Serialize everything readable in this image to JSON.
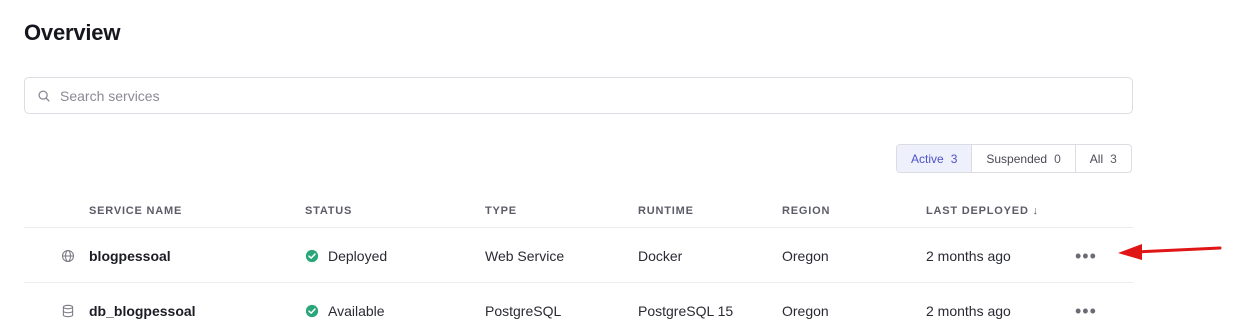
{
  "page": {
    "title": "Overview"
  },
  "search": {
    "placeholder": "Search services"
  },
  "filters": [
    {
      "label": "Active",
      "count": "3",
      "active": true
    },
    {
      "label": "Suspended",
      "count": "0",
      "active": false
    },
    {
      "label": "All",
      "count": "3",
      "active": false
    }
  ],
  "table": {
    "columns": {
      "service_name": "SERVICE NAME",
      "status": "STATUS",
      "type": "TYPE",
      "runtime": "RUNTIME",
      "region": "REGION",
      "last_deployed": "LAST DEPLOYED ↓"
    },
    "rows": [
      {
        "icon": "globe-icon",
        "name": "blogpessoal",
        "status": "Deployed",
        "type": "Web Service",
        "runtime": "Docker",
        "region": "Oregon",
        "last_deployed": "2 months ago",
        "more": "•••"
      },
      {
        "icon": "database-icon",
        "name": "db_blogpessoal",
        "status": "Available",
        "type": "PostgreSQL",
        "runtime": "PostgreSQL 15",
        "region": "Oregon",
        "last_deployed": "2 months ago",
        "more": "•••"
      }
    ]
  },
  "colors": {
    "accent": "#4d52c9",
    "success": "#2aa67a",
    "annotation": "#e01515"
  }
}
